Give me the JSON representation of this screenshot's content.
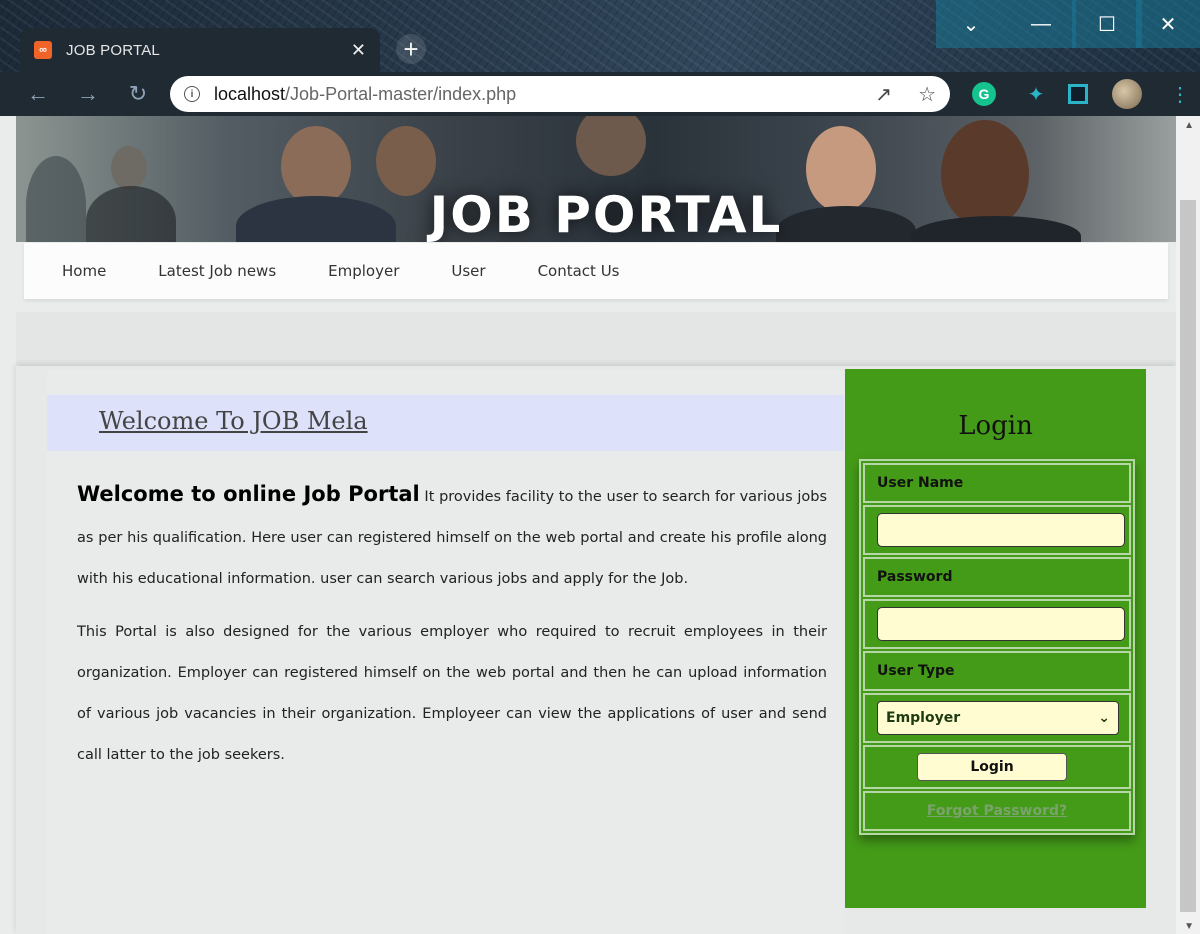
{
  "browser": {
    "tab_title": "JOB PORTAL",
    "tab_favicon": "xampp-icon",
    "url_host": "localhost",
    "url_path": "/Job-Portal-master/index.php"
  },
  "site": {
    "banner_title": "JOB PORTAL",
    "nav": [
      "Home",
      "Latest Job news",
      "Employer",
      "User",
      "Contact Us"
    ]
  },
  "main": {
    "heading": "Welcome To JOB Mela",
    "lead": "Welcome to online Job Portal",
    "para1_rest": " It provides facility to the user to search for various jobs as per his qualification. Here user can registered himself on the web portal and create his profile along with his educational information. user can search various jobs and apply for the Job.",
    "para2": "This Portal is also designed for the various employer who required to recruit employees in their organization. Employer can registered himself on the web portal and then he can upload information of various job vacancies in their organization. Employeer can view the applications of user and send call latter to the job seekers."
  },
  "login": {
    "title": "Login",
    "username_label": "User Name",
    "username_value": "",
    "password_label": "Password",
    "password_value": "",
    "usertype_label": "User Type",
    "usertype_selected": "Employer",
    "login_button": "Login",
    "forgot_link": "Forgot Password?"
  },
  "colors": {
    "login_panel": "#449b18",
    "input_bg": "#fffcd2",
    "welcome_bar": "#dde1f9"
  }
}
